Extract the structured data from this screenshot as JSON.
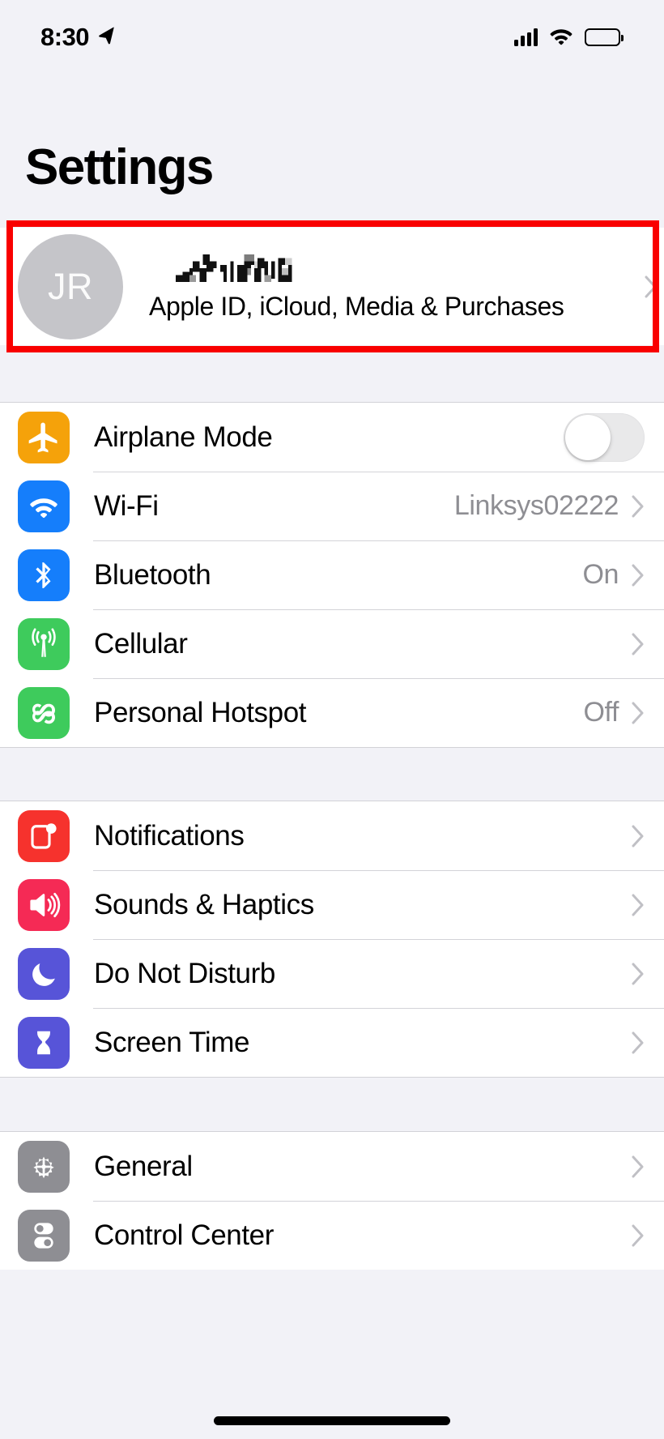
{
  "status_bar": {
    "time": "8:30",
    "location_icon": "location-arrow-icon",
    "signal_icon": "cellular-signal-icon",
    "wifi_icon": "wifi-icon",
    "battery_icon": "battery-full-icon"
  },
  "header": {
    "title": "Settings"
  },
  "account": {
    "avatar_initials": "JR",
    "name_redacted": true,
    "name_label": "redacted-account-name",
    "subtitle": "Apple ID, iCloud, Media & Purchases",
    "chevron": "chevron-right-icon",
    "highlight_color": "#f90000"
  },
  "groups": [
    {
      "id": "connectivity",
      "rows": [
        {
          "label": "Airplane Mode",
          "icon": "airplane-icon",
          "icon_color": "#f5a20a",
          "control": "toggle",
          "toggle_on": false,
          "value": ""
        },
        {
          "label": "Wi-Fi",
          "icon": "wifi-icon",
          "icon_color": "#157efb",
          "control": "chevron",
          "value": "Linksys02222"
        },
        {
          "label": "Bluetooth",
          "icon": "bluetooth-icon",
          "icon_color": "#157efb",
          "control": "chevron",
          "value": "On"
        },
        {
          "label": "Cellular",
          "icon": "cellular-antenna-icon",
          "icon_color": "#3ecb5c",
          "control": "chevron",
          "value": ""
        },
        {
          "label": "Personal Hotspot",
          "icon": "hotspot-link-icon",
          "icon_color": "#3ecb5c",
          "control": "chevron",
          "value": "Off"
        }
      ]
    },
    {
      "id": "alerts",
      "rows": [
        {
          "label": "Notifications",
          "icon": "notifications-badge-icon",
          "icon_color": "#f6322d",
          "control": "chevron",
          "value": ""
        },
        {
          "label": "Sounds & Haptics",
          "icon": "speaker-waves-icon",
          "icon_color": "#f52a55",
          "control": "chevron",
          "value": ""
        },
        {
          "label": "Do Not Disturb",
          "icon": "crescent-moon-icon",
          "icon_color": "#5754d8",
          "control": "chevron",
          "value": ""
        },
        {
          "label": "Screen Time",
          "icon": "hourglass-icon",
          "icon_color": "#5754d8",
          "control": "chevron",
          "value": ""
        }
      ]
    },
    {
      "id": "system",
      "rows": [
        {
          "label": "General",
          "icon": "gear-icon",
          "icon_color": "#8e8e93",
          "control": "chevron",
          "value": ""
        },
        {
          "label": "Control Center",
          "icon": "control-center-toggles-icon",
          "icon_color": "#8e8e93",
          "control": "chevron",
          "value": ""
        }
      ]
    }
  ],
  "home_indicator": "home-indicator-bar"
}
